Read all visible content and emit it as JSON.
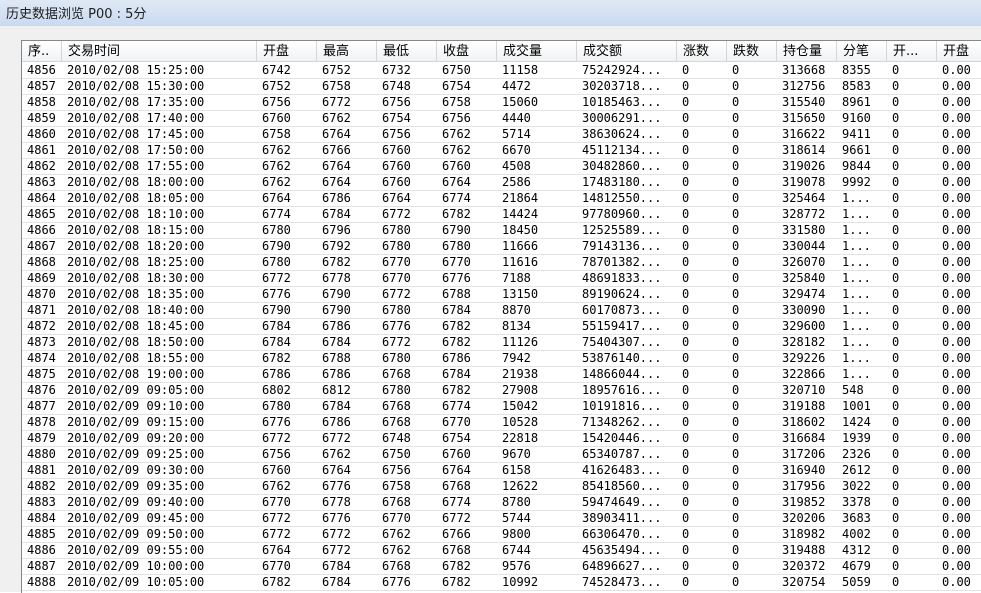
{
  "window": {
    "title": "历史数据浏览 P00 : 5分"
  },
  "table": {
    "columns": [
      "序..",
      "交易时间",
      "开盘",
      "最高",
      "最低",
      "收盘",
      "成交量",
      "成交额",
      "涨数",
      "跌数",
      "持仓量",
      "分笔",
      "开...",
      "开盘"
    ],
    "rows": [
      [
        "4856",
        "2010/02/08 15:25:00",
        "6742",
        "6752",
        "6732",
        "6750",
        "11158",
        "75242924...",
        "0",
        "0",
        "313668",
        "8355",
        "0",
        "0.00"
      ],
      [
        "4857",
        "2010/02/08 15:30:00",
        "6752",
        "6758",
        "6748",
        "6754",
        "4472",
        "30203718...",
        "0",
        "0",
        "312756",
        "8583",
        "0",
        "0.00"
      ],
      [
        "4858",
        "2010/02/08 17:35:00",
        "6756",
        "6772",
        "6756",
        "6758",
        "15060",
        "10185463...",
        "0",
        "0",
        "315540",
        "8961",
        "0",
        "0.00"
      ],
      [
        "4859",
        "2010/02/08 17:40:00",
        "6760",
        "6762",
        "6754",
        "6756",
        "4440",
        "30006291...",
        "0",
        "0",
        "315650",
        "9160",
        "0",
        "0.00"
      ],
      [
        "4860",
        "2010/02/08 17:45:00",
        "6758",
        "6764",
        "6756",
        "6762",
        "5714",
        "38630624...",
        "0",
        "0",
        "316622",
        "9411",
        "0",
        "0.00"
      ],
      [
        "4861",
        "2010/02/08 17:50:00",
        "6762",
        "6766",
        "6760",
        "6762",
        "6670",
        "45112134...",
        "0",
        "0",
        "318614",
        "9661",
        "0",
        "0.00"
      ],
      [
        "4862",
        "2010/02/08 17:55:00",
        "6762",
        "6764",
        "6760",
        "6760",
        "4508",
        "30482860...",
        "0",
        "0",
        "319026",
        "9844",
        "0",
        "0.00"
      ],
      [
        "4863",
        "2010/02/08 18:00:00",
        "6762",
        "6764",
        "6760",
        "6764",
        "2586",
        "17483180...",
        "0",
        "0",
        "319078",
        "9992",
        "0",
        "0.00"
      ],
      [
        "4864",
        "2010/02/08 18:05:00",
        "6764",
        "6786",
        "6764",
        "6774",
        "21864",
        "14812550...",
        "0",
        "0",
        "325464",
        "1...",
        "0",
        "0.00"
      ],
      [
        "4865",
        "2010/02/08 18:10:00",
        "6774",
        "6784",
        "6772",
        "6782",
        "14424",
        "97780960...",
        "0",
        "0",
        "328772",
        "1...",
        "0",
        "0.00"
      ],
      [
        "4866",
        "2010/02/08 18:15:00",
        "6780",
        "6796",
        "6780",
        "6790",
        "18450",
        "12525589...",
        "0",
        "0",
        "331580",
        "1...",
        "0",
        "0.00"
      ],
      [
        "4867",
        "2010/02/08 18:20:00",
        "6790",
        "6792",
        "6780",
        "6780",
        "11666",
        "79143136...",
        "0",
        "0",
        "330044",
        "1...",
        "0",
        "0.00"
      ],
      [
        "4868",
        "2010/02/08 18:25:00",
        "6780",
        "6782",
        "6770",
        "6770",
        "11616",
        "78701382...",
        "0",
        "0",
        "326070",
        "1...",
        "0",
        "0.00"
      ],
      [
        "4869",
        "2010/02/08 18:30:00",
        "6772",
        "6778",
        "6770",
        "6776",
        "7188",
        "48691833...",
        "0",
        "0",
        "325840",
        "1...",
        "0",
        "0.00"
      ],
      [
        "4870",
        "2010/02/08 18:35:00",
        "6776",
        "6790",
        "6772",
        "6788",
        "13150",
        "89190624...",
        "0",
        "0",
        "329474",
        "1...",
        "0",
        "0.00"
      ],
      [
        "4871",
        "2010/02/08 18:40:00",
        "6790",
        "6790",
        "6780",
        "6784",
        "8870",
        "60170873...",
        "0",
        "0",
        "330090",
        "1...",
        "0",
        "0.00"
      ],
      [
        "4872",
        "2010/02/08 18:45:00",
        "6784",
        "6786",
        "6776",
        "6782",
        "8134",
        "55159417...",
        "0",
        "0",
        "329600",
        "1...",
        "0",
        "0.00"
      ],
      [
        "4873",
        "2010/02/08 18:50:00",
        "6784",
        "6784",
        "6772",
        "6782",
        "11126",
        "75404307...",
        "0",
        "0",
        "328182",
        "1...",
        "0",
        "0.00"
      ],
      [
        "4874",
        "2010/02/08 18:55:00",
        "6782",
        "6788",
        "6780",
        "6786",
        "7942",
        "53876140...",
        "0",
        "0",
        "329226",
        "1...",
        "0",
        "0.00"
      ],
      [
        "4875",
        "2010/02/08 19:00:00",
        "6786",
        "6786",
        "6768",
        "6784",
        "21938",
        "14866044...",
        "0",
        "0",
        "322866",
        "1...",
        "0",
        "0.00"
      ],
      [
        "4876",
        "2010/02/09 09:05:00",
        "6802",
        "6812",
        "6780",
        "6782",
        "27908",
        "18957616...",
        "0",
        "0",
        "320710",
        "548",
        "0",
        "0.00"
      ],
      [
        "4877",
        "2010/02/09 09:10:00",
        "6780",
        "6784",
        "6768",
        "6774",
        "15042",
        "10191816...",
        "0",
        "0",
        "319188",
        "1001",
        "0",
        "0.00"
      ],
      [
        "4878",
        "2010/02/09 09:15:00",
        "6776",
        "6786",
        "6768",
        "6770",
        "10528",
        "71348262...",
        "0",
        "0",
        "318602",
        "1424",
        "0",
        "0.00"
      ],
      [
        "4879",
        "2010/02/09 09:20:00",
        "6772",
        "6772",
        "6748",
        "6754",
        "22818",
        "15420446...",
        "0",
        "0",
        "316684",
        "1939",
        "0",
        "0.00"
      ],
      [
        "4880",
        "2010/02/09 09:25:00",
        "6756",
        "6762",
        "6750",
        "6760",
        "9670",
        "65340787...",
        "0",
        "0",
        "317206",
        "2326",
        "0",
        "0.00"
      ],
      [
        "4881",
        "2010/02/09 09:30:00",
        "6760",
        "6764",
        "6756",
        "6764",
        "6158",
        "41626483...",
        "0",
        "0",
        "316940",
        "2612",
        "0",
        "0.00"
      ],
      [
        "4882",
        "2010/02/09 09:35:00",
        "6762",
        "6776",
        "6758",
        "6768",
        "12622",
        "85418560...",
        "0",
        "0",
        "317956",
        "3022",
        "0",
        "0.00"
      ],
      [
        "4883",
        "2010/02/09 09:40:00",
        "6770",
        "6778",
        "6768",
        "6774",
        "8780",
        "59474649...",
        "0",
        "0",
        "319852",
        "3378",
        "0",
        "0.00"
      ],
      [
        "4884",
        "2010/02/09 09:45:00",
        "6772",
        "6776",
        "6770",
        "6772",
        "5744",
        "38903411...",
        "0",
        "0",
        "320206",
        "3683",
        "0",
        "0.00"
      ],
      [
        "4885",
        "2010/02/09 09:50:00",
        "6772",
        "6772",
        "6762",
        "6766",
        "9800",
        "66306470...",
        "0",
        "0",
        "318982",
        "4002",
        "0",
        "0.00"
      ],
      [
        "4886",
        "2010/02/09 09:55:00",
        "6764",
        "6772",
        "6762",
        "6768",
        "6744",
        "45635494...",
        "0",
        "0",
        "319488",
        "4312",
        "0",
        "0.00"
      ],
      [
        "4887",
        "2010/02/09 10:00:00",
        "6770",
        "6784",
        "6768",
        "6782",
        "9576",
        "64896627...",
        "0",
        "0",
        "320372",
        "4679",
        "0",
        "0.00"
      ],
      [
        "4888",
        "2010/02/09 10:05:00",
        "6782",
        "6784",
        "6776",
        "6782",
        "10992",
        "74528473...",
        "0",
        "0",
        "320754",
        "5059",
        "0",
        "0.00"
      ]
    ]
  }
}
